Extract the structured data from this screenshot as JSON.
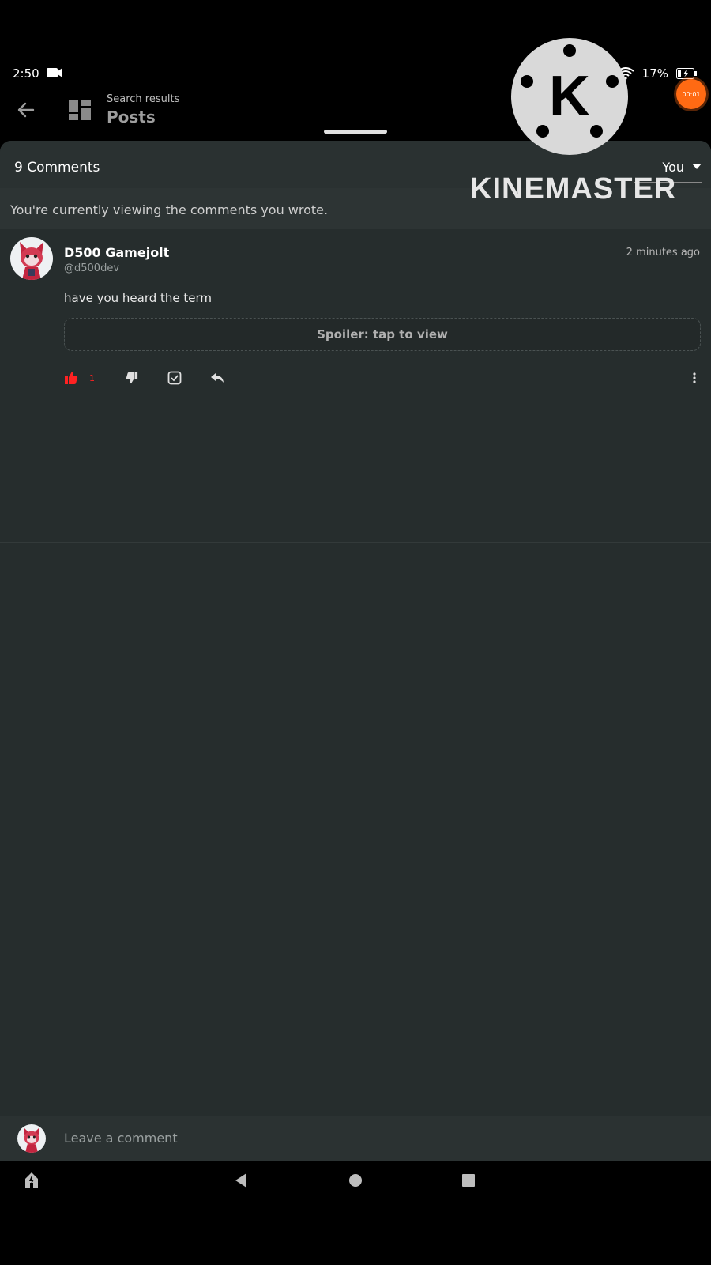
{
  "status_bar": {
    "time": "2:50",
    "battery": "17%"
  },
  "app_bar": {
    "breadcrumb": "Search results",
    "title": "Posts"
  },
  "comments_sheet": {
    "count_label": "9 Comments",
    "filter_value": "You",
    "notice": "You're currently viewing the comments you wrote."
  },
  "comment": {
    "author_name": "D500 Gamejolt",
    "author_handle": "@d500dev",
    "timestamp": "2 minutes ago",
    "text": "have you heard the term",
    "spoiler_label": "Spoiler: tap to view",
    "like_count": "1"
  },
  "compose": {
    "placeholder": "Leave a comment"
  },
  "watermark": {
    "text": "KINEMASTER",
    "logo_letter": "K",
    "recording_time": "00:01"
  },
  "colors": {
    "background": "#000000",
    "sheet": "#262d2d",
    "like_active": "#ff2222",
    "recording": "#ff6a13"
  },
  "icons": [
    "camera-icon",
    "wifi-icon",
    "battery-icon",
    "back-arrow-icon",
    "dashboard-icon",
    "chevron-down-icon",
    "thumbs-up-icon",
    "thumbs-down-icon",
    "sticker-icon",
    "reply-icon",
    "more-vertical-icon",
    "gamejolt-icon",
    "back-triangle-icon",
    "home-circle-icon",
    "recents-square-icon"
  ]
}
